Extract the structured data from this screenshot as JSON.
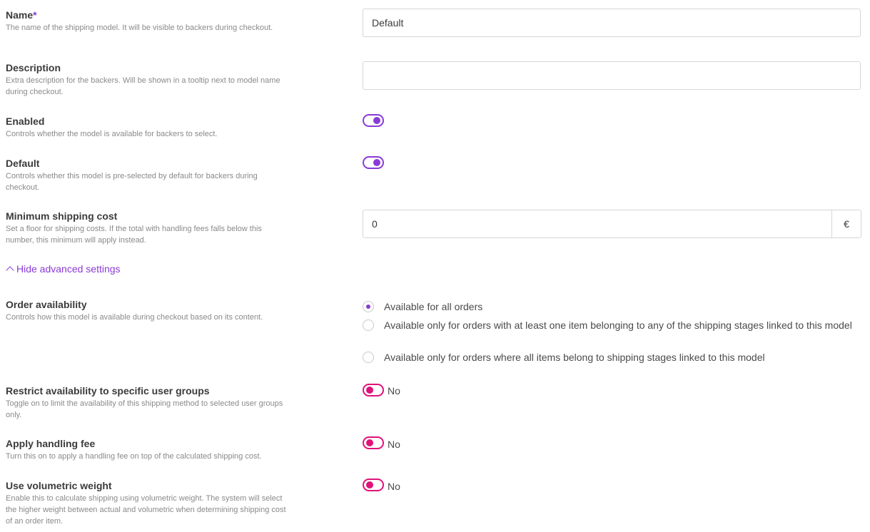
{
  "fields": {
    "name": {
      "title": "Name",
      "required_mark": "*",
      "desc": "The name of the shipping model. It will be visible to backers during checkout.",
      "value": "Default"
    },
    "description": {
      "title": "Description",
      "desc": "Extra description for the backers. Will be shown in a tooltip next to model name during checkout.",
      "value": ""
    },
    "enabled": {
      "title": "Enabled",
      "desc": "Controls whether the model is available for backers to select.",
      "on": true
    },
    "default": {
      "title": "Default",
      "desc": "Controls whether this model is pre-selected by default for backers during checkout.",
      "on": true
    },
    "min_cost": {
      "title": "Minimum shipping cost",
      "desc": "Set a floor for shipping costs. If the total with handling fees falls below this number, this minimum will apply instead.",
      "value": "0",
      "suffix": "€"
    }
  },
  "advanced_toggle": "Hide advanced settings",
  "order_availability": {
    "title": "Order availability",
    "desc": "Controls how this model is available during checkout based on its content.",
    "options": [
      "Available for all orders",
      "Available only for orders with at least one item belonging to any of the shipping stages linked to this model",
      "Available only for orders where all items belong to shipping stages linked to this model"
    ],
    "selected_index": 0
  },
  "restrict_groups": {
    "title": "Restrict availability to specific user groups",
    "desc": "Toggle on to limit the availability of this shipping method to selected user groups only.",
    "state_text": "No"
  },
  "handling_fee": {
    "title": "Apply handling fee",
    "desc": "Turn this on to apply a handling fee on top of the calculated shipping cost.",
    "state_text": "No"
  },
  "volumetric": {
    "title": "Use volumetric weight",
    "desc": "Enable this to calculate shipping using volumetric weight. The system will select the higher weight between actual and volumetric when determining shipping cost of an order item.",
    "state_text": "No"
  },
  "colors": {
    "accent": "#8a3ad6",
    "off_toggle": "#e0127a"
  }
}
